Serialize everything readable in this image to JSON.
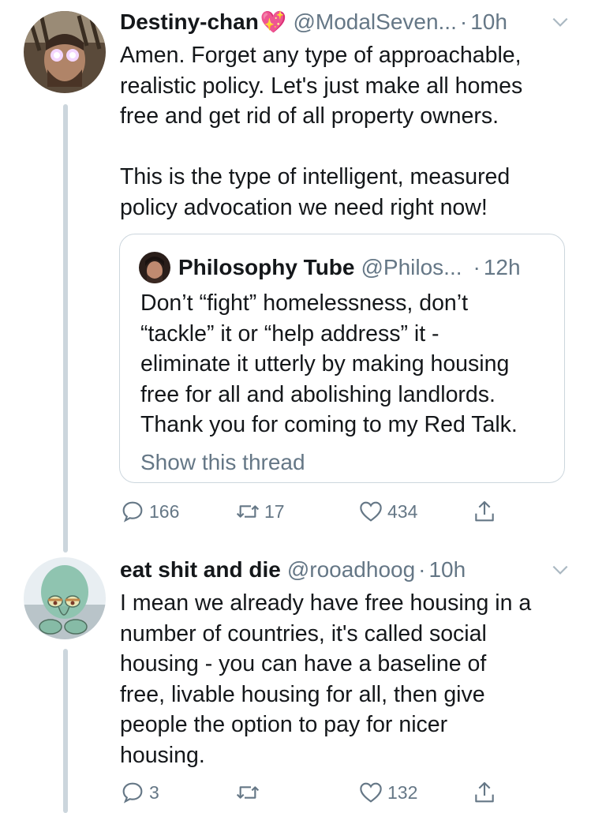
{
  "tweets": [
    {
      "name": "Destiny-chan",
      "name_emoji": "💖",
      "handle": "@ModalSeven...",
      "dot": "·",
      "time": "10h",
      "text": "Amen. Forget any type of approachable,\nrealistic policy. Let's just make all homes\nfree and get rid of all property owners.\n\nThis is the type of intelligent, measured\npolicy advocation we need right now!",
      "quote": {
        "name": "Philosophy Tube",
        "handle": "@Philos...",
        "dot": "·",
        "time": "12h",
        "text": "Don’t “fight” homelessness, don’t\n“tackle” it or “help address” it -\neliminate it utterly by making housing\nfree for all and abolishing landlords.\nThank you for coming to my Red Talk.",
        "show_thread": "Show this thread"
      },
      "actions": {
        "replies": "166",
        "retweets": "17",
        "likes": "434"
      }
    },
    {
      "name": "eat shit and die",
      "handle": "@rooadhoog",
      "dot": "·",
      "time": "10h",
      "text": "I mean we already have free housing in a\nnumber of countries, it's called social\nhousing - you can have a baseline of\nfree, livable housing for all, then give\npeople the option to pay for nicer\nhousing.",
      "actions": {
        "replies": "3",
        "retweets": "",
        "likes": "132"
      }
    }
  ],
  "icons": {
    "reply": "reply-icon",
    "retweet": "retweet-icon",
    "like": "heart-icon",
    "share": "share-icon",
    "menu": "chevron-down-icon"
  },
  "colors": {
    "text": "#14171a",
    "secondary": "#657786",
    "border": "#ccd6dd",
    "heart": "#e0245e"
  }
}
